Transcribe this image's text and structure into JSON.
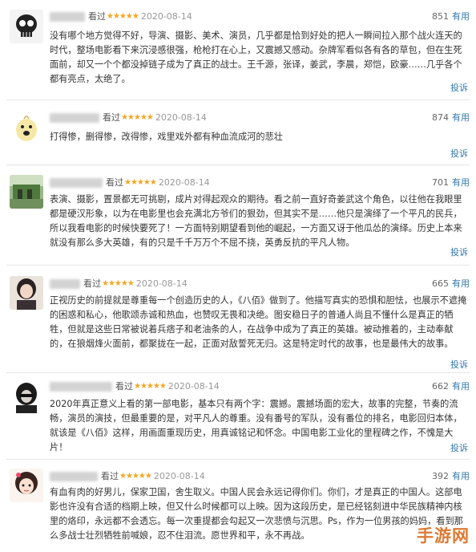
{
  "reviews": [
    {
      "status": "看过",
      "stars": "★★★★★",
      "date": "2020-08-14",
      "votes": "851",
      "useful": "有用",
      "text": "没有哪个地方觉得不好，导演、摄影、美术、演员，几乎都是恰到好处的把人一瞬间拉入那个战火连天的时代，整场电影看下来沉浸感很强，枪枪打在心上，又震撼又感动。杂牌军看似各有各的草包，但在生死面前，却又一个个都没掉链子成为了真正的战士。王千源，张译，姜武，李晨，郑恺，欧豪……几乎各个都有亮点，太绝了。",
      "report": "投诉"
    },
    {
      "status": "看过",
      "stars": "★★★★★",
      "date": "2020-08-14",
      "votes": "874",
      "useful": "有用",
      "text": "打得惨，删得惨，改得惨，戏里戏外都有种血流成河的悲壮",
      "report": "投诉"
    },
    {
      "status": "看过",
      "stars": "★★★★★",
      "date": "2020-08-14",
      "votes": "701",
      "useful": "有用",
      "text": "表演、摄影，置景都无可挑剔，成片对得起观众的期待。看之前一直好奇姜武这个角色，以往他在我眼里都是硬汉形象，以为在电影里也会充满北方爷们的狠劲，但其实不是……他只是演绎了一个平凡的民兵，所以我看电影的时候快要死了！一方面特别期望看到他的崛起，一方面又讶于他瓜怂的演绎。历史上本来就没有那么多大英雄，有的只是千千万万个不屈不挠，英勇反抗的平凡人物。",
      "report": "投诉"
    },
    {
      "status": "看过",
      "stars": "★★★★★",
      "date": "2020-08-14",
      "votes": "665",
      "useful": "有用",
      "text": "正视历史的前提就是尊重每一个创造历史的人，《八佰》做到了。他描写真实的恐惧和胆怯，也展示不遮掩的困惑和私心，他歌颂赤诚和热血，也赞叹无畏和决绝。图安稳日子的普通人尚且不懂什么是真正的牺牲，但就是这些日常被说着兵痞子和老油条的人，在战争中成为了真正的英雄。被动推着的，主动奉献的，在狼烟烽火面前，都聚拢在一起，正面对敌誓死无归。这是特定时代的故事，也是最伟大的故事。",
      "report": "投诉"
    },
    {
      "status": "看过",
      "stars": "★★★★★",
      "date": "2020-08-14",
      "votes": "662",
      "useful": "有用",
      "text": "2020年真正意义上看的第一部电影，基本只有两个字：震撼。震撼场面的宏大，故事的完整，节奏的流畅，演员的演技，但最重要的是，对平凡人的尊重。没有番号的军队，没有番位的排名，电影回归本体，就该是《八佰》这样，用画面重现历史，用真诚铭记和怀念。中国电影工业化的里程碑之作，不愧是大片！",
      "report": "投诉"
    },
    {
      "status": "看过",
      "stars": "★★★★★",
      "date": "2020-08-14",
      "votes": "392",
      "useful": "有用",
      "text": "有血有肉的好男儿，保家卫国，舍生取义。中国人民会永远记得你们。你们，才是真正的中国人。这部电影也许没有合适的档期上映，但又什么时候都可以上映。因为这段历史，是已经铭刻进中华民族精神内核里的烙印，永远都不会透忘。每一次重提都会勾起又一次悲愤与沉思。Ps，作为一位男孩的妈妈，看到那么多战士壮烈牺牲前喊娘，忍不住泪流。愿世界和平，永不再战。",
      "report": "投诉"
    }
  ],
  "watermark": {
    "text": "手游网",
    "color": "#d86c1f"
  },
  "colors": {
    "link": "#3377aa",
    "star": "#f5a623",
    "text": "#333333",
    "date": "#999999"
  }
}
